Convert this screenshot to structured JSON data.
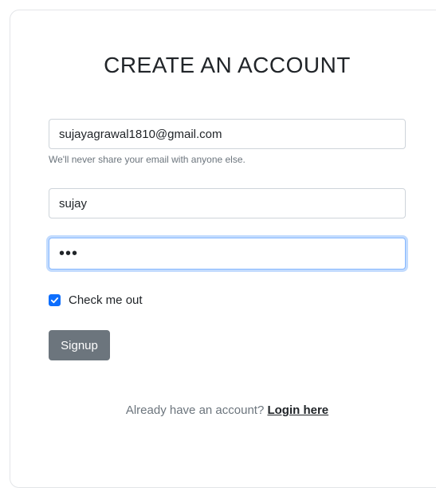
{
  "form": {
    "title": "CREATE AN ACCOUNT",
    "email_value": "sujayagrawal1810@gmail.com",
    "email_help": "We'll never share your email with anyone else.",
    "name_value": "sujay",
    "password_value": "•••",
    "checkbox_label": "Check me out",
    "checkbox_checked": true,
    "submit_label": "Signup",
    "footer_text": "Already have an account? ",
    "login_link": "Login here"
  },
  "colors": {
    "accent": "#0d6efd",
    "button": "#6c757d",
    "focus_border": "#86b7fe"
  }
}
